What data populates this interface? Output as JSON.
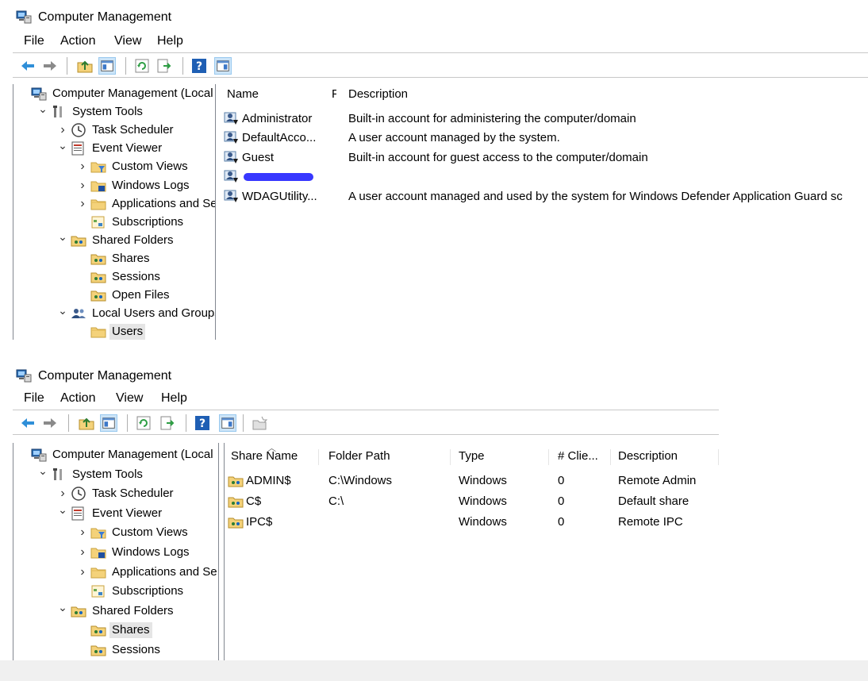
{
  "window1": {
    "title": "Computer Management",
    "menu": [
      "File",
      "Action",
      "View",
      "Help"
    ],
    "icons": [
      "back-arrow-icon",
      "forward-arrow-icon",
      "up-folder-icon",
      "show-hide-tree-icon",
      "refresh-icon",
      "export-list-icon",
      "help-icon",
      "show-hide-action-pane-icon"
    ],
    "tree": [
      {
        "label": "Computer Management (Local",
        "expander": "",
        "icon": "computer-management-icon"
      },
      {
        "label": "System Tools",
        "expander": "v",
        "icon": "system-tools-icon"
      },
      {
        "label": "Task Scheduler",
        "expander": ">",
        "icon": "clock-icon"
      },
      {
        "label": "Event Viewer",
        "expander": "v",
        "icon": "event-viewer-icon"
      },
      {
        "label": "Custom Views",
        "expander": ">",
        "icon": "filter-folder-icon"
      },
      {
        "label": "Windows Logs",
        "expander": ">",
        "icon": "log-folder-icon"
      },
      {
        "label": "Applications and Se",
        "expander": ">",
        "icon": "folder-icon"
      },
      {
        "label": "Subscriptions",
        "expander": "",
        "icon": "subscriptions-icon"
      },
      {
        "label": "Shared Folders",
        "expander": "v",
        "icon": "shared-folder-icon"
      },
      {
        "label": "Shares",
        "expander": "",
        "icon": "shared-folder-icon"
      },
      {
        "label": "Sessions",
        "expander": "",
        "icon": "shared-folder-icon"
      },
      {
        "label": "Open Files",
        "expander": "",
        "icon": "shared-folder-icon"
      },
      {
        "label": "Local Users and Groups",
        "expander": "v",
        "icon": "users-groups-icon"
      },
      {
        "label": "Users",
        "expander": "",
        "icon": "folder-icon",
        "selected": true
      }
    ],
    "columns": {
      "name": "Name",
      "full_name": "F",
      "description": "Description"
    },
    "rows": [
      {
        "name": "Administrator",
        "description": "Built-in account for administering the computer/domain"
      },
      {
        "name": "DefaultAcco...",
        "description": "A user account managed by the system."
      },
      {
        "name": "Guest",
        "description": "Built-in account for guest access to the computer/domain"
      },
      {
        "name": "",
        "description": "",
        "redacted": true
      },
      {
        "name": "WDAGUtility...",
        "description": "A user account managed and used by the system for Windows Defender Application Guard sc"
      }
    ]
  },
  "window2": {
    "title": "Computer Management",
    "menu": [
      "File",
      "Action",
      "View",
      "Help"
    ],
    "icons": [
      "back-arrow-icon",
      "forward-arrow-icon",
      "up-folder-icon",
      "show-hide-tree-icon",
      "refresh-icon",
      "export-list-icon",
      "help-icon",
      "show-hide-action-pane-icon",
      "new-share-icon"
    ],
    "tree": [
      {
        "label": "Computer Management (Local",
        "expander": "",
        "icon": "computer-management-icon"
      },
      {
        "label": "System Tools",
        "expander": "v",
        "icon": "system-tools-icon"
      },
      {
        "label": "Task Scheduler",
        "expander": ">",
        "icon": "clock-icon"
      },
      {
        "label": "Event Viewer",
        "expander": "v",
        "icon": "event-viewer-icon"
      },
      {
        "label": "Custom Views",
        "expander": ">",
        "icon": "filter-folder-icon"
      },
      {
        "label": "Windows Logs",
        "expander": ">",
        "icon": "log-folder-icon"
      },
      {
        "label": "Applications and Se",
        "expander": ">",
        "icon": "folder-icon"
      },
      {
        "label": "Subscriptions",
        "expander": "",
        "icon": "subscriptions-icon"
      },
      {
        "label": "Shared Folders",
        "expander": "v",
        "icon": "shared-folder-icon"
      },
      {
        "label": "Shares",
        "expander": "",
        "icon": "shared-folder-open-icon",
        "selected": true
      },
      {
        "label": "Sessions",
        "expander": "",
        "icon": "shared-folder-icon"
      }
    ],
    "columns": {
      "share_name": "Share Name",
      "folder_path": "Folder Path",
      "type": "Type",
      "clients": "# Clie...",
      "description": "Description"
    },
    "rows": [
      {
        "share_name": "ADMIN$",
        "folder_path": "C:\\Windows",
        "type": "Windows",
        "clients": "0",
        "description": "Remote Admin"
      },
      {
        "share_name": "C$",
        "folder_path": "C:\\",
        "type": "Windows",
        "clients": "0",
        "description": "Default share"
      },
      {
        "share_name": "IPC$",
        "folder_path": "",
        "type": "Windows",
        "clients": "0",
        "description": "Remote IPC"
      }
    ]
  }
}
